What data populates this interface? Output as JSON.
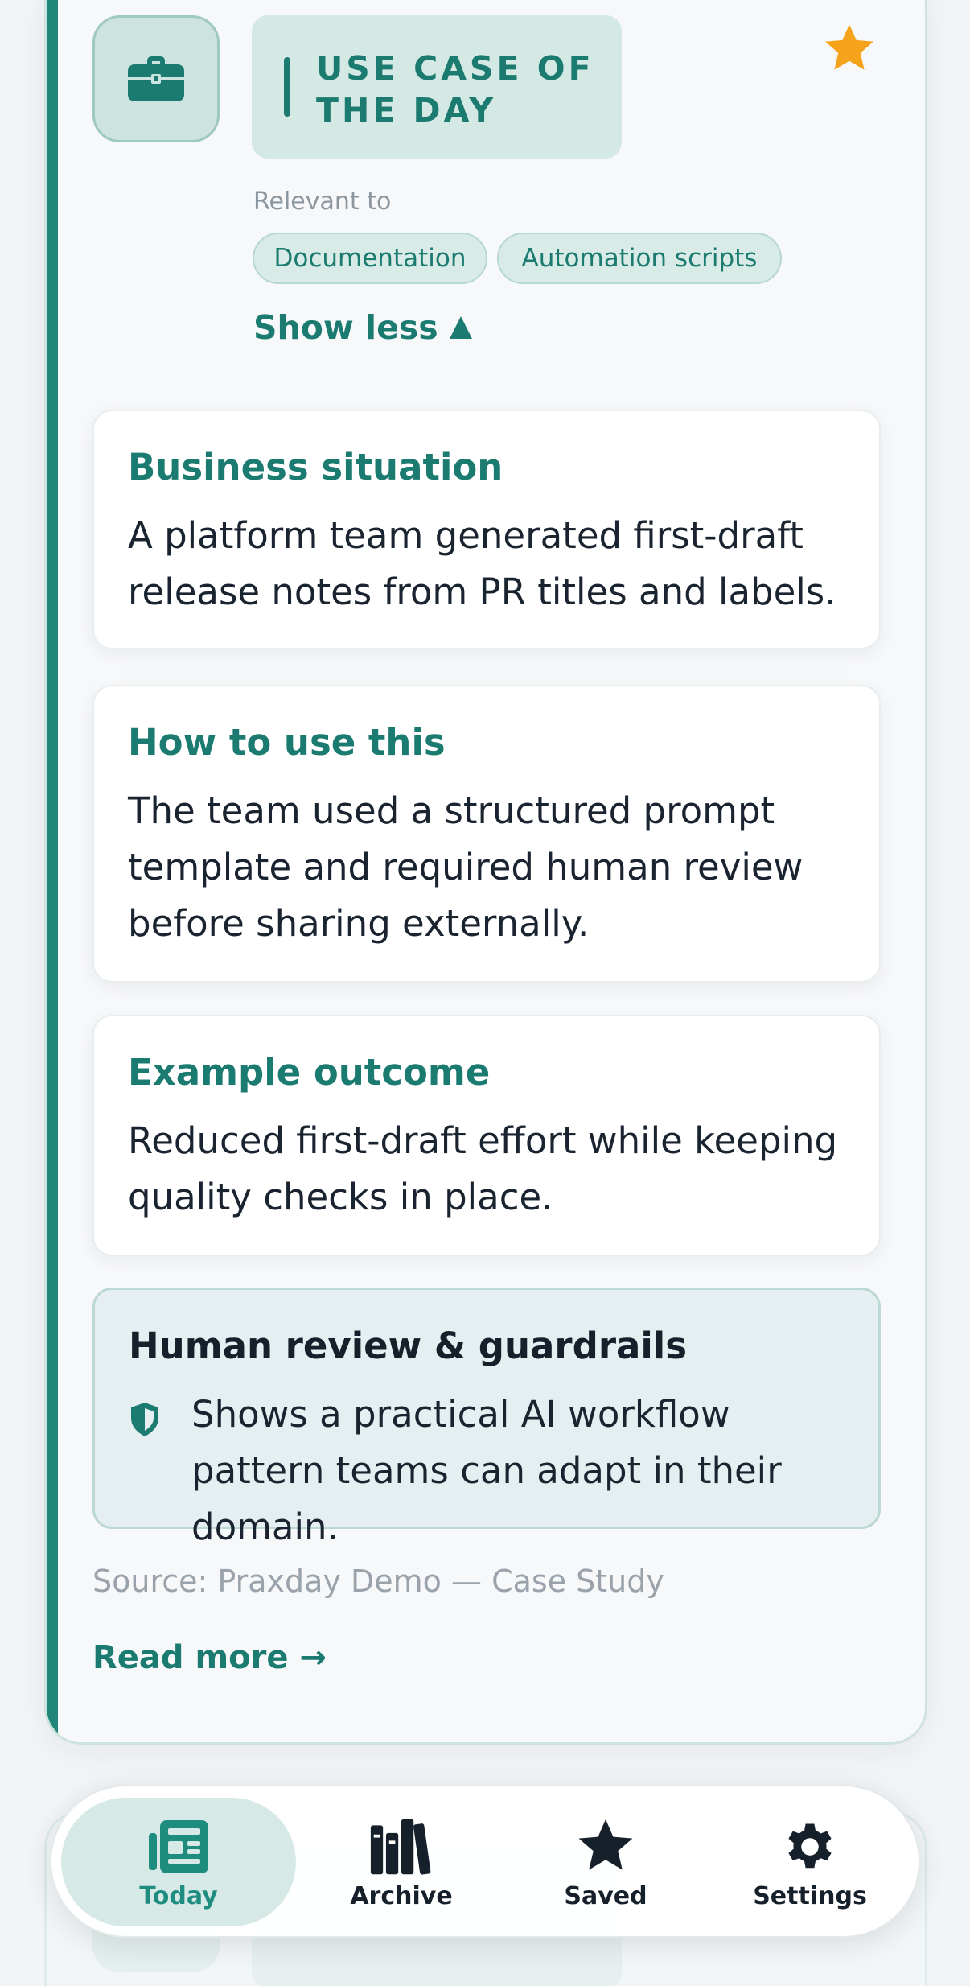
{
  "card": {
    "label": "USE CASE OF THE DAY",
    "relevant_label": "Relevant to",
    "tags": [
      "Documentation",
      "Automation scripts"
    ],
    "toggle_label": "Show less",
    "sections": [
      {
        "title": "Business situation",
        "body": "A platform team generated first-draft release notes from PR titles and labels."
      },
      {
        "title": "How to use this",
        "body": "The team used a structured prompt template and required human review before sharing externally."
      },
      {
        "title": "Example outcome",
        "body": "Reduced first-draft effort while keeping quality checks in place."
      }
    ],
    "guardrails": {
      "title": "Human review & guardrails",
      "body": "Shows a practical AI workflow pattern teams can adapt in their domain."
    },
    "source": "Source: Praxday Demo — Case Study",
    "read_more": "Read more →",
    "icon": "briefcase-icon",
    "favorite_icon": "star-icon"
  },
  "tabbar": {
    "tabs": [
      {
        "label": "Today",
        "icon": "newspaper-icon",
        "active": true
      },
      {
        "label": "Archive",
        "icon": "books-icon",
        "active": false
      },
      {
        "label": "Saved",
        "icon": "star-icon",
        "active": false
      },
      {
        "label": "Settings",
        "icon": "gear-icon",
        "active": false
      }
    ]
  },
  "colors": {
    "accent": "#1b7b70",
    "accent_light": "#d4e8e4",
    "star": "#f5a31a",
    "text": "#16202b",
    "muted": "#9aa3ab"
  }
}
